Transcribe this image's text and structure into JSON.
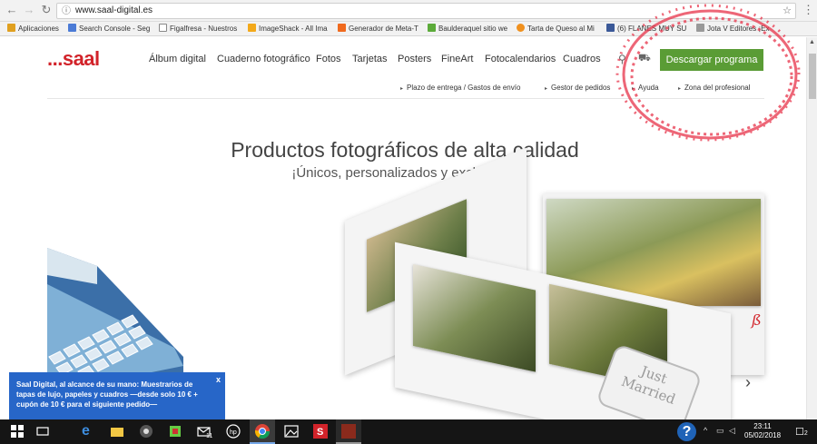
{
  "browser": {
    "url": "www.saal-digital.es",
    "bookmarks": [
      {
        "label": "Aplicaciones",
        "color": "#e0a020"
      },
      {
        "label": "Search Console - Seg",
        "color": "#4b7bd6"
      },
      {
        "label": "Figalfresa - Nuestros",
        "color": "#888888"
      },
      {
        "label": "ImageShack - All Ima",
        "color": "#f3a91a"
      },
      {
        "label": "Generador de Meta-T",
        "color": "#f06a1e"
      },
      {
        "label": "Baulderaquel sitio we",
        "color": "#5cab3a"
      },
      {
        "label": "Tarta de Queso al Mi",
        "color": "#f0901e"
      },
      {
        "label": "(6) FLANES MUY SU",
        "color": "#3b5998"
      },
      {
        "label": "Jota V Editores ¡Ex",
        "color": "#999999"
      }
    ]
  },
  "site": {
    "logo": "...saal",
    "nav": [
      "Álbum digital",
      "Cuaderno fotográfico",
      "Fotos",
      "Tarjetas",
      "Posters",
      "FineArt",
      "Fotocalendarios",
      "Cuadros"
    ],
    "download_label": "Descargar programa",
    "subnav": [
      "Plazo de entrega / Gastos de envío",
      "Gestor de pedidos",
      "Ayuda",
      "Zona del profesional"
    ],
    "hero_title": "Productos fotográficos de alta calidad",
    "hero_subtitle": "¡Únicos, personalizados y exclusivos!",
    "card_text_line1": "Just",
    "card_text_line2": "Married",
    "promo_text": "Saal Digital, al alcance de su mano: Muestrarios de tapas de lujo, papeles y cuadros —desde solo 10 € + cupón de 10 € para el siguiente pedido—",
    "promo_close": "x"
  },
  "taskbar": {
    "time": "23:11",
    "date": "05/02/2018",
    "mail_badge": "11",
    "notif_count": "2"
  },
  "colors": {
    "brand_red": "#d2232a",
    "download_green": "#5a9c35",
    "promo_blue": "#2766c8"
  }
}
